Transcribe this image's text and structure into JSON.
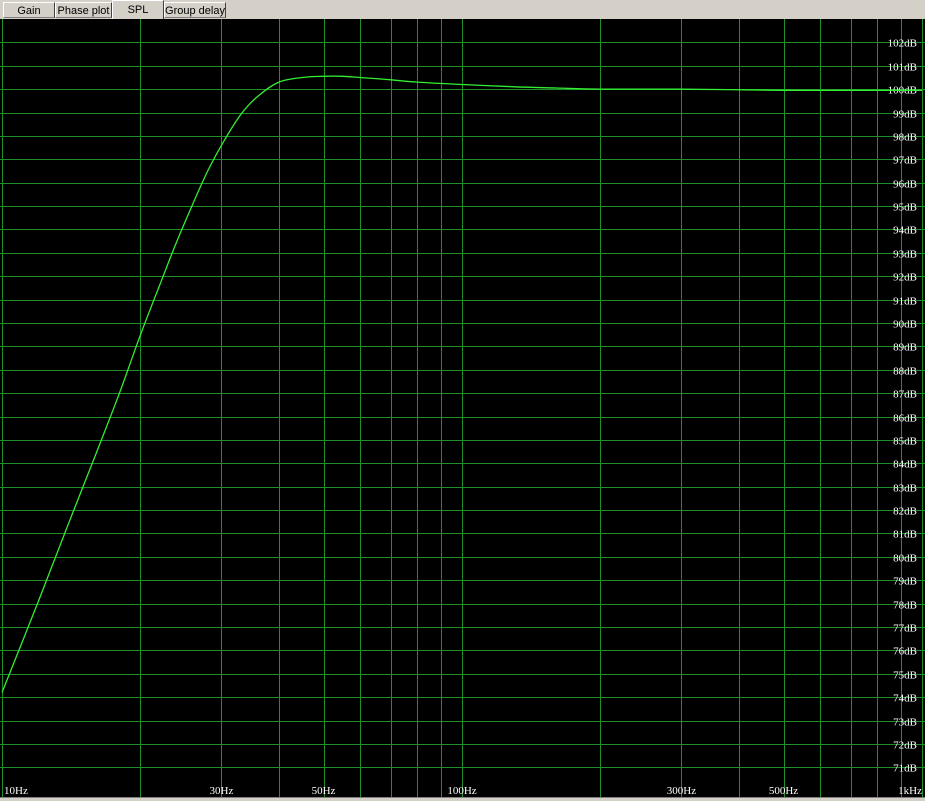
{
  "tabs": [
    {
      "label": "Gain",
      "active": false
    },
    {
      "label": "Phase plot",
      "active": false
    },
    {
      "label": "SPL",
      "active": true
    },
    {
      "label": "Group delay",
      "active": false
    }
  ],
  "colors": {
    "background": "#000000",
    "grid": "#1f8f2a",
    "curve": "#33ee33",
    "text": "#ffffff"
  },
  "chart_data": {
    "type": "line",
    "title": "",
    "xlabel": "",
    "ylabel": "",
    "xscale": "log",
    "xlim": [
      10,
      1000
    ],
    "ylim": [
      70.5,
      103
    ],
    "grid": true,
    "x_tick_labels": [
      {
        "value": 10,
        "label": "10Hz"
      },
      {
        "value": 30,
        "label": "30Hz"
      },
      {
        "value": 50,
        "label": "50Hz"
      },
      {
        "value": 100,
        "label": "100Hz"
      },
      {
        "value": 300,
        "label": "300Hz"
      },
      {
        "value": 500,
        "label": "500Hz"
      },
      {
        "value": 1000,
        "label": "1kHz"
      }
    ],
    "x_gridlines": [
      10,
      20,
      30,
      40,
      50,
      60,
      70,
      80,
      90,
      100,
      200,
      300,
      400,
      500,
      600,
      700,
      800,
      900,
      1000
    ],
    "y_tick_labels": [
      "71dB",
      "72dB",
      "73dB",
      "74dB",
      "75dB",
      "76dB",
      "77dB",
      "78dB",
      "79dB",
      "80dB",
      "81dB",
      "82dB",
      "83dB",
      "84dB",
      "85dB",
      "86dB",
      "87dB",
      "88dB",
      "89dB",
      "90dB",
      "91dB",
      "92dB",
      "93dB",
      "94dB",
      "95dB",
      "96dB",
      "97dB",
      "98dB",
      "99dB",
      "100dB",
      "101dB",
      "102dB"
    ],
    "series": [
      {
        "x": [
          10,
          12,
          14,
          16,
          18,
          20,
          22,
          24,
          26,
          28,
          30,
          33,
          36,
          40,
          45,
          50,
          55,
          60,
          70,
          80,
          100,
          130,
          160,
          200,
          300,
          500,
          700,
          1000
        ],
        "y": [
          74.2,
          78.1,
          81.5,
          84.4,
          87.0,
          89.5,
          91.6,
          93.5,
          95.1,
          96.5,
          97.6,
          98.9,
          99.7,
          100.3,
          100.5,
          100.55,
          100.55,
          100.5,
          100.4,
          100.3,
          100.2,
          100.1,
          100.05,
          100.0,
          100.0,
          99.95,
          99.95,
          99.95
        ]
      }
    ]
  }
}
